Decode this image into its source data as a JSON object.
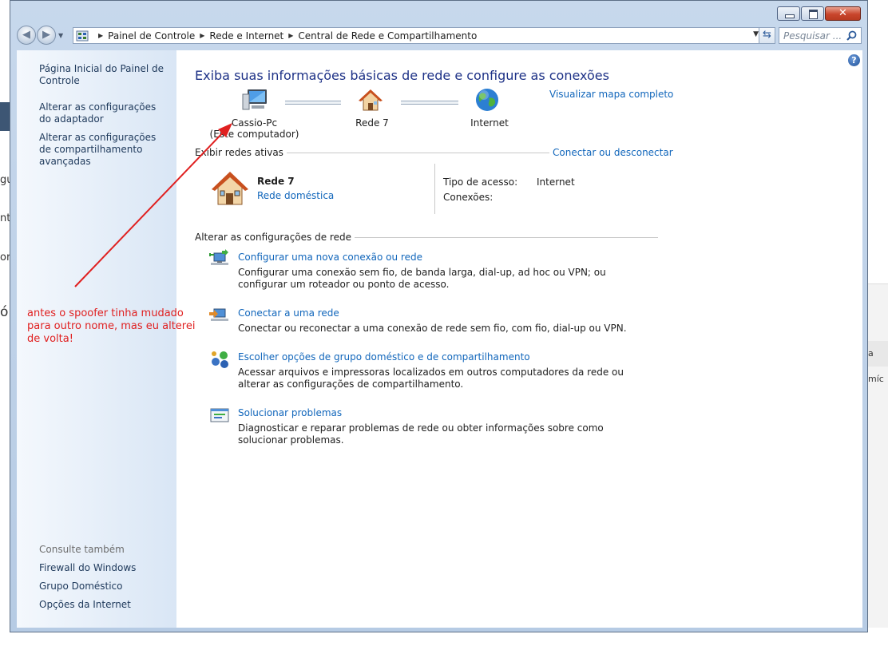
{
  "window": {
    "breadcrumbs": [
      "Painel de Controle",
      "Rede e Internet",
      "Central de Rede e Compartilhamento"
    ],
    "search_placeholder": "Pesquisar ..."
  },
  "sidebar": {
    "links": [
      "Página Inicial do Painel de Controle",
      "Alterar as configurações do adaptador",
      "Alterar as configurações de compartilhamento avançadas"
    ],
    "see_also_heading": "Consulte também",
    "see_also": [
      "Firewall do Windows",
      "Grupo Doméstico",
      "Opções da Internet"
    ]
  },
  "main": {
    "title": "Exiba suas informações básicas de rede e configure as conexões",
    "full_map_link": "Visualizar mapa completo",
    "map": {
      "computer_name": "Cassio-Pc",
      "computer_sub": "(Este computador)",
      "network": "Rede 7",
      "internet": "Internet"
    },
    "active_networks_label": "Exibir redes ativas",
    "connect_disconnect_link": "Conectar ou desconectar",
    "active_network": {
      "name": "Rede  7",
      "type": "Rede doméstica",
      "access_type_label": "Tipo de acesso:",
      "access_type_value": "Internet",
      "connections_label": "Conexões:"
    },
    "change_settings_label": "Alterar as configurações de rede",
    "tasks": [
      {
        "icon": "new-connection-icon",
        "title": "Configurar uma nova conexão ou rede",
        "desc": "Configurar uma conexão sem fio, de banda larga, dial-up, ad hoc ou VPN; ou configurar um roteador ou ponto de acesso."
      },
      {
        "icon": "connect-network-icon",
        "title": "Conectar a uma rede",
        "desc": "Conectar ou reconectar a uma conexão de rede sem fio, com fio, dial-up ou VPN."
      },
      {
        "icon": "homegroup-icon",
        "title": "Escolher opções de grupo doméstico e de compartilhamento",
        "desc": "Acessar arquivos e impressoras localizados em outros computadores da rede ou alterar as configurações de compartilhamento."
      },
      {
        "icon": "troubleshoot-icon",
        "title": "Solucionar problemas",
        "desc": "Diagnosticar e reparar problemas de rede ou obter informações sobre como solucionar problemas."
      }
    ]
  },
  "annotation": {
    "text": "antes o spoofer tinha mudado para outro nome, mas eu alterei de volta!",
    "color": "#e02020"
  },
  "background": {
    "left_fragments": [
      "gu",
      "nt",
      "ori",
      "ó"
    ],
    "right_fragment": "a míc"
  },
  "colors": {
    "link": "#1166bb",
    "title": "#1e3287",
    "sidebar_link": "#1e395b"
  }
}
